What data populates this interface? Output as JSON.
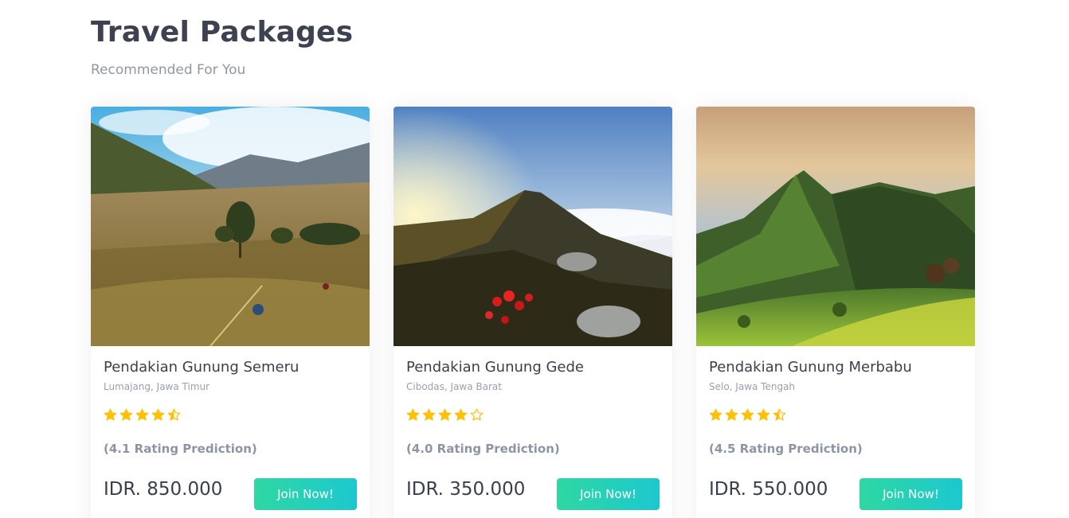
{
  "header": {
    "title": "Travel Packages",
    "subtitle": "Recommended For You"
  },
  "colors": {
    "star": "#ffc107",
    "button_gradient_start": "#2ed8a3",
    "button_gradient_end": "#1cc8cf",
    "heading": "#3d4150",
    "muted": "#9097a3"
  },
  "packages": [
    {
      "image_icon": "mountain-valley-photo",
      "title": "Pendakian Gunung Semeru",
      "location": "Lumajang, Jawa Timur",
      "rating": 4.5,
      "rating_label": "(4.1 Rating Prediction)",
      "price": "IDR. 850.000",
      "button_label": "Join Now!"
    },
    {
      "image_icon": "volcano-sunrise-photo",
      "title": "Pendakian Gunung Gede",
      "location": "Cibodas, Jawa Barat",
      "rating": 4,
      "rating_label": "(4.0 Rating Prediction)",
      "price": "IDR. 350.000",
      "button_label": "Join Now!"
    },
    {
      "image_icon": "green-ridge-photo",
      "title": "Pendakian Gunung Merbabu",
      "location": "Selo, Jawa Tengah",
      "rating": 4.5,
      "rating_label": "(4.5 Rating Prediction)",
      "price": "IDR. 550.000",
      "button_label": "Join Now!"
    }
  ]
}
